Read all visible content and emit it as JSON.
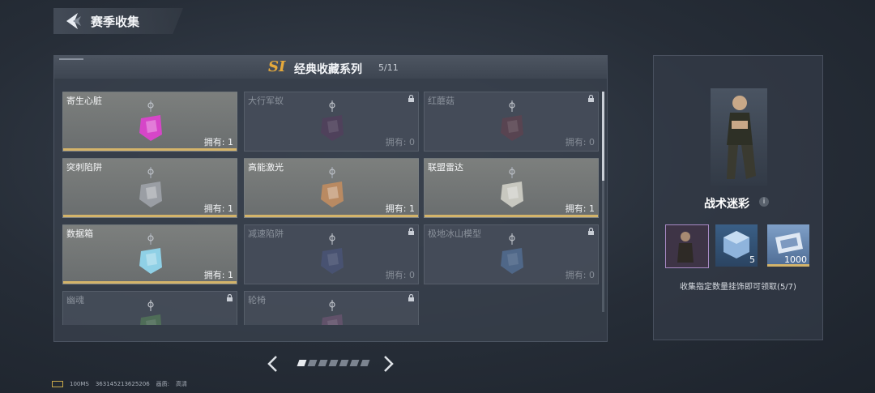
{
  "header": {
    "title": "赛季收集"
  },
  "series": {
    "badge": "SI",
    "title": "经典收藏系列",
    "count": "5/11"
  },
  "owned_prefix": "拥有:",
  "cards": [
    {
      "name": "寄生心脏",
      "owned": "拥有: 1",
      "state": "owned",
      "icon": "pink-heart-pendant-icon",
      "color": "#d646c8"
    },
    {
      "name": "大行军蚁",
      "owned": "拥有: 0",
      "state": "locked",
      "icon": "ant-pendant-icon",
      "color": "#5a3a5e"
    },
    {
      "name": "红蘑菇",
      "owned": "拥有: 0",
      "state": "locked",
      "icon": "mushroom-pendant-icon",
      "color": "#6a3f4d"
    },
    {
      "name": "突刺陷阱",
      "owned": "拥有: 1",
      "state": "owned",
      "icon": "spike-trap-pendant-icon",
      "color": "#9a9ea4"
    },
    {
      "name": "高能激光",
      "owned": "拥有: 1",
      "state": "owned",
      "icon": "laser-pendant-icon",
      "color": "#b98a62"
    },
    {
      "name": "联盟雷达",
      "owned": "拥有: 1",
      "state": "owned",
      "icon": "radar-pendant-icon",
      "color": "#c8c8c0"
    },
    {
      "name": "数据箱",
      "owned": "拥有: 1",
      "state": "owned",
      "icon": "data-box-pendant-icon",
      "color": "#8fd0e6"
    },
    {
      "name": "减速陷阱",
      "owned": "拥有: 0",
      "state": "locked",
      "icon": "slow-trap-pendant-icon",
      "color": "#4c5a86"
    },
    {
      "name": "极地冰山模型",
      "owned": "拥有: 0",
      "state": "locked",
      "icon": "iceberg-pendant-icon",
      "color": "#5a7fb0"
    },
    {
      "name": "幽魂",
      "owned": "",
      "state": "locked",
      "icon": "ghost-pendant-icon",
      "color": "#5a8a5a"
    },
    {
      "name": "轮椅",
      "owned": "",
      "state": "locked",
      "icon": "wheelchair-pendant-icon",
      "color": "#7a5a7a"
    }
  ],
  "pagination": {
    "pages": 7,
    "current": 1
  },
  "reward": {
    "name": "战术迷彩",
    "info_icon": "i",
    "items": [
      {
        "icon": "character-skin-icon",
        "qty": ""
      },
      {
        "icon": "crate-icon",
        "qty": "5"
      },
      {
        "icon": "ticket-icon",
        "qty": "1000"
      }
    ],
    "hint": "收集指定数量挂饰即可领取(5/7)"
  },
  "footer": {
    "ping": "100MS",
    "uid": "363145213625206",
    "quality_label": "画质:",
    "quality_value": "高清"
  }
}
